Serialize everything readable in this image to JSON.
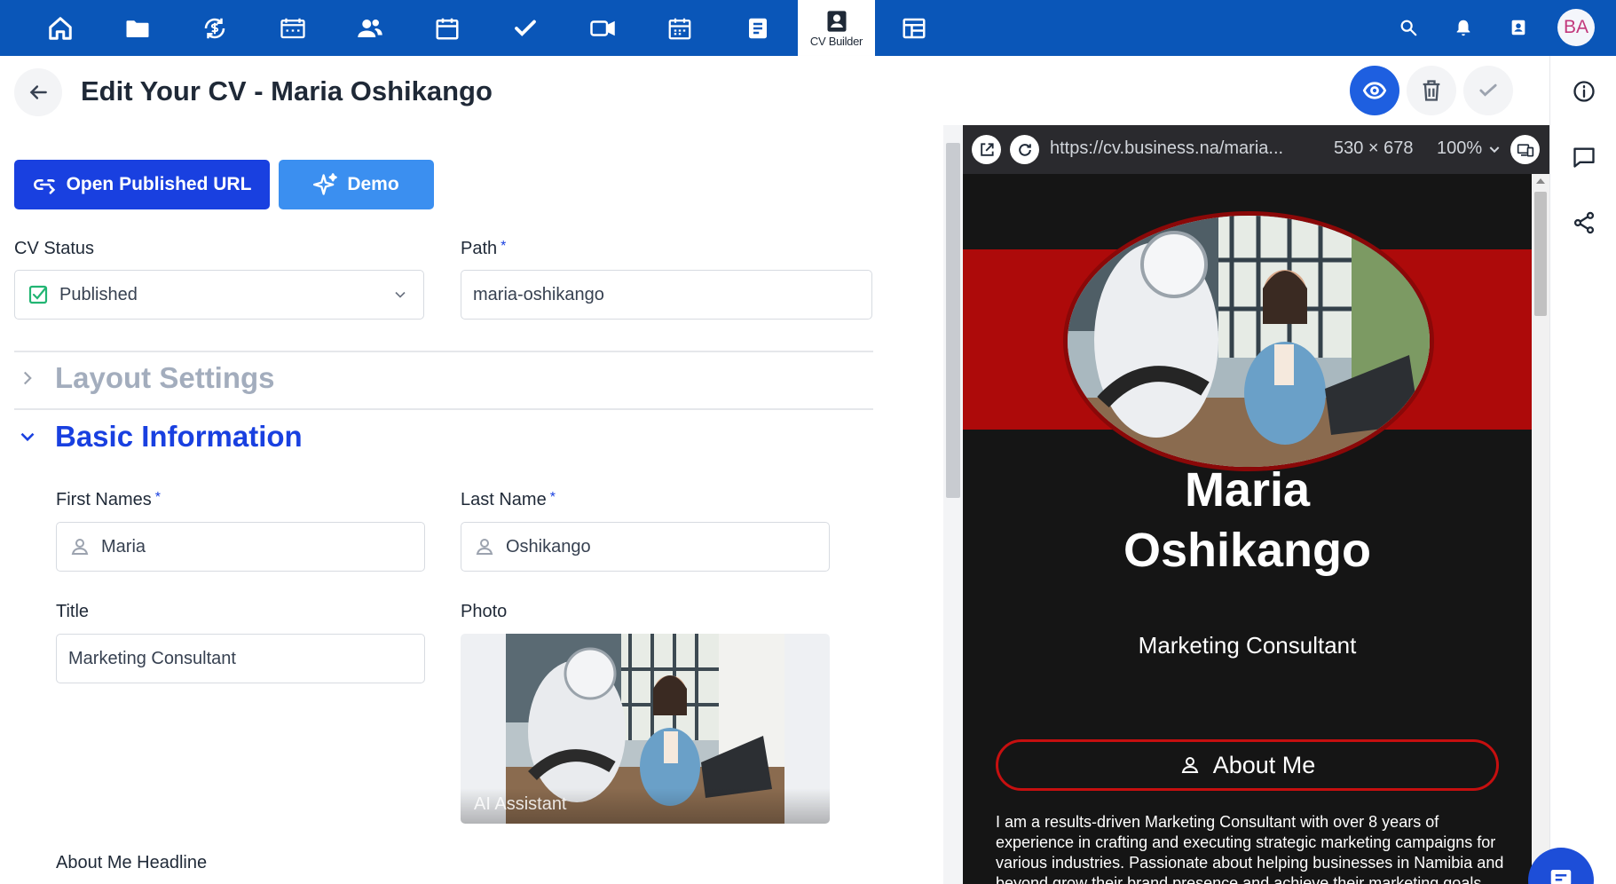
{
  "nav": {
    "icons": [
      "home-icon",
      "folder-icon",
      "finance-icon",
      "board-icon",
      "contacts-icon",
      "calendar-icon",
      "tasks-icon",
      "video-icon",
      "schedule-icon",
      "notes-icon"
    ],
    "active_label": "CV Builder",
    "after_active_icon": "layout-icon",
    "right_icons": [
      "search-icon",
      "bell-icon",
      "contact-card-icon"
    ],
    "avatar_initials": "BA"
  },
  "header": {
    "title": "Edit Your CV - Maria Oshikango",
    "actions": [
      "eye-icon",
      "trash-icon",
      "check-icon"
    ]
  },
  "rail": {
    "icons": [
      "info-icon",
      "comment-icon",
      "share-icon"
    ]
  },
  "form": {
    "open_url_label": "Open Published URL",
    "demo_label": "Demo",
    "cv_status": {
      "label": "CV Status",
      "value": "Published"
    },
    "path": {
      "label": "Path",
      "value": "maria-oshikango"
    },
    "layout_section": "Layout Settings",
    "basic_section": "Basic Information",
    "first_names": {
      "label": "First Names",
      "value": "Maria"
    },
    "last_name": {
      "label": "Last Name",
      "value": "Oshikango"
    },
    "title": {
      "label": "Title",
      "value": "Marketing Consultant"
    },
    "photo": {
      "label": "Photo",
      "overlay": "AI Assistant"
    },
    "about_headline": {
      "label": "About Me Headline"
    },
    "required_mark": "*"
  },
  "preview": {
    "url": "https://cv.business.na/maria...",
    "size": "530 × 678",
    "zoom": "100%",
    "first_name": "Maria",
    "last_name": "Oshikango",
    "title": "Marketing Consultant",
    "about_button": "About Me",
    "about_text": "I am a results-driven Marketing Consultant with over 8 years of experience in crafting and executing strategic marketing campaigns for various industries. Passionate about helping businesses in Namibia and beyond grow their brand presence and achieve their marketing goals."
  },
  "colors": {
    "nav_bg": "#0a56b8",
    "primary": "#1940e0",
    "demo": "#3b8ff0",
    "preview_bg": "#151515",
    "preview_accent": "#ad0a0a"
  }
}
